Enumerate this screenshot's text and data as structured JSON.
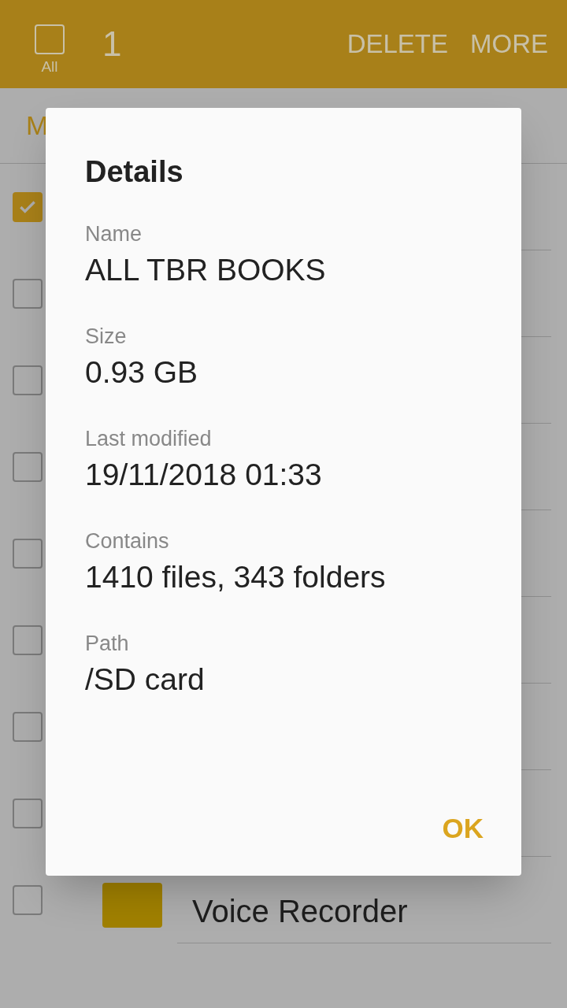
{
  "action_bar": {
    "select_all": {
      "label": "All",
      "checked": false
    },
    "count": "1",
    "actions": [
      "DELETE",
      "MORE"
    ]
  },
  "tab": {
    "label": "M"
  },
  "rows": [
    {
      "checked": true
    },
    {
      "checked": false
    },
    {
      "checked": false
    },
    {
      "checked": false
    },
    {
      "checked": false
    },
    {
      "checked": false
    },
    {
      "checked": false
    },
    {
      "checked": false
    },
    {
      "checked": false,
      "kind": "folder",
      "label": "Voice Recorder"
    }
  ],
  "dialog": {
    "title": "Details",
    "fields": [
      {
        "label": "Name",
        "value": "ALL TBR BOOKS"
      },
      {
        "label": "Size",
        "value": "0.93 GB"
      },
      {
        "label": "Last modified",
        "value": "19/11/2018 01:33"
      },
      {
        "label": "Contains",
        "value": "1410 files, 343 folders"
      },
      {
        "label": "Path",
        "value": "/SD card"
      }
    ],
    "button": "OK"
  }
}
